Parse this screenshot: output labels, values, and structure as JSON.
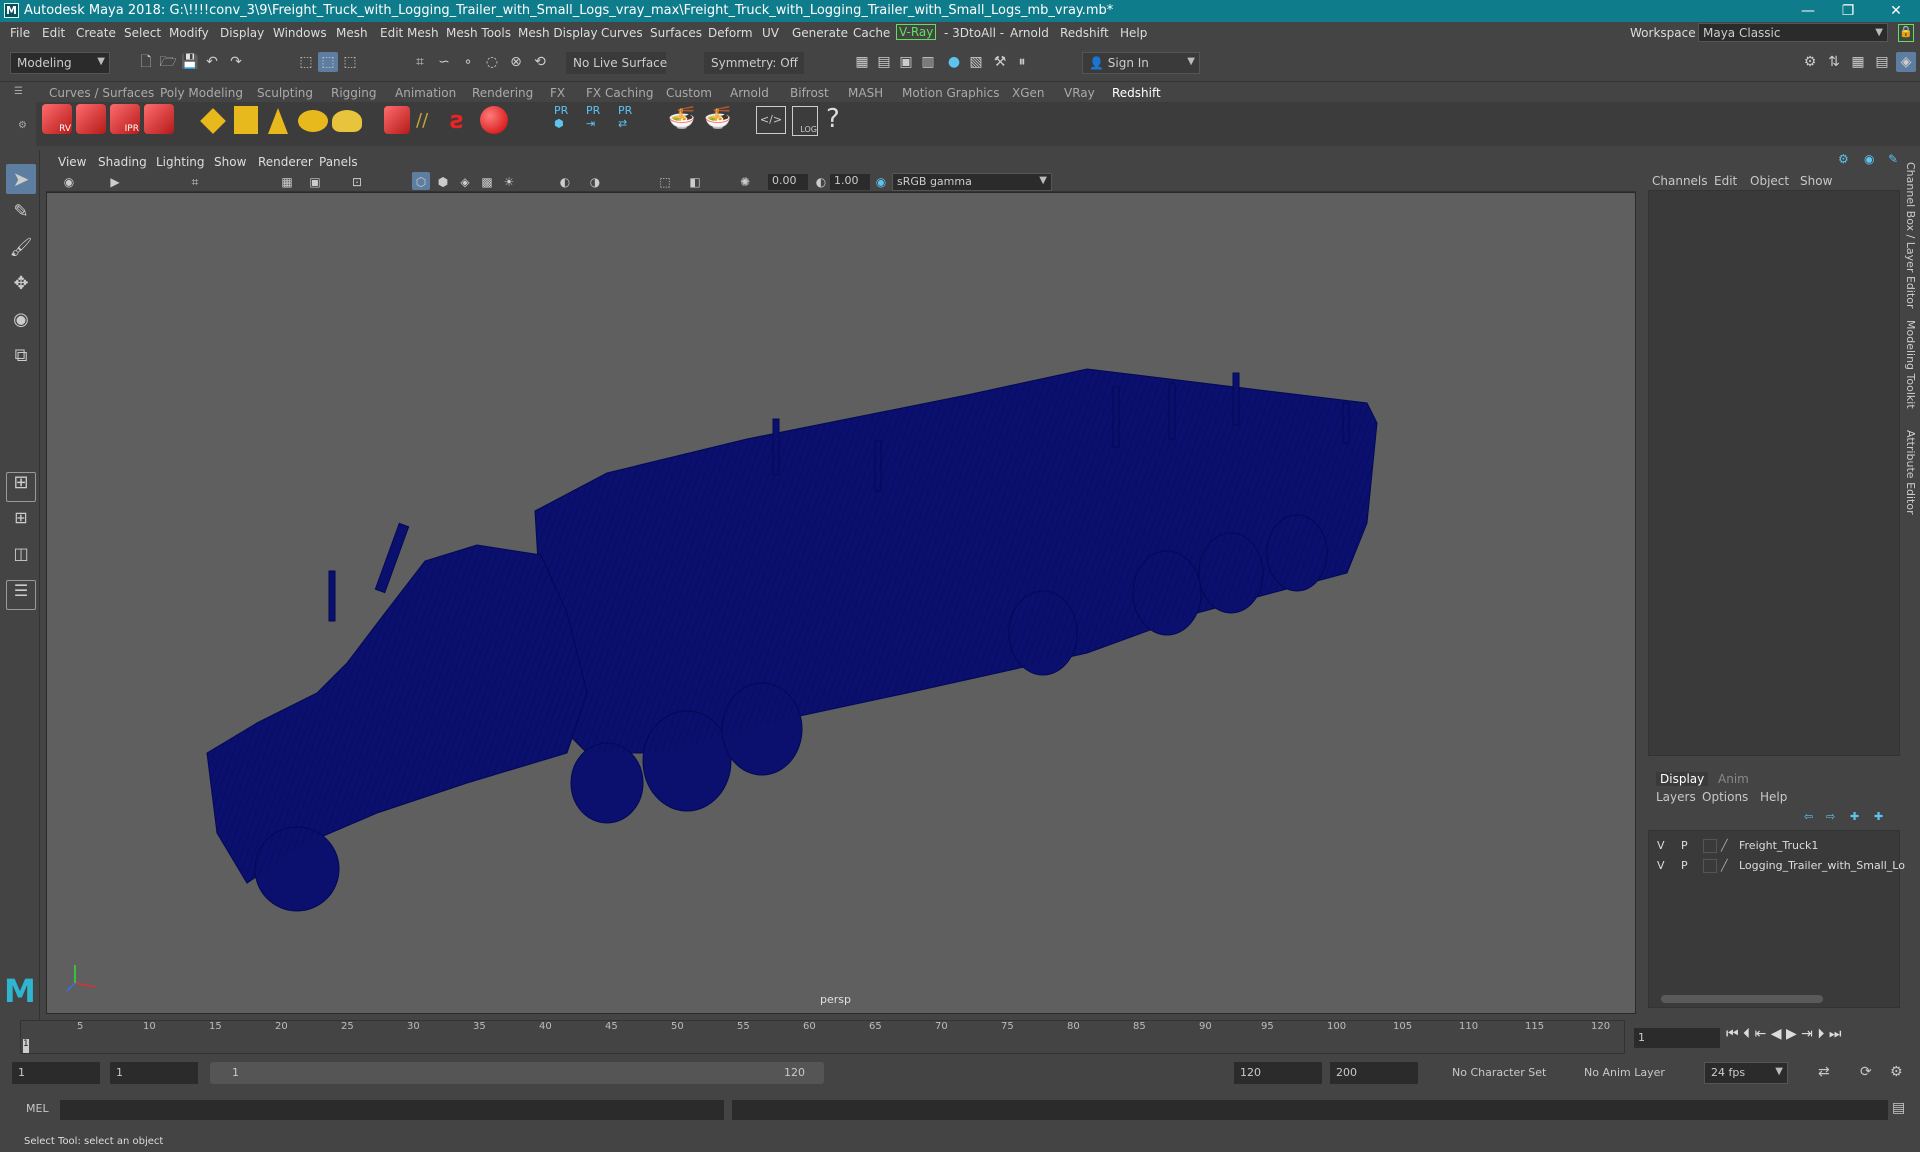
{
  "title": "Autodesk Maya 2018: G:\\!!!!conv_3\\9\\Freight_Truck_with_Logging_Trailer_with_Small_Logs_vray_max\\Freight_Truck_with_Logging_Trailer_with_Small_Logs_mb_vray.mb*",
  "window_controls": {
    "minimize": "—",
    "restore": "❐",
    "close": "✕"
  },
  "menus": [
    "File",
    "Edit",
    "Create",
    "Select",
    "Modify",
    "Display",
    "Windows",
    "Mesh",
    "Edit Mesh",
    "Mesh Tools",
    "Mesh Display",
    "Curves",
    "Surfaces",
    "Deform",
    "UV",
    "Generate",
    "Cache",
    "V-Ray",
    "- 3DtoAll -",
    "Arnold",
    "Redshift",
    "Help"
  ],
  "workspace": {
    "label": "Workspace :",
    "value": "Maya Classic"
  },
  "toolbar": {
    "mode": "Modeling",
    "live_surface": "No Live Surface",
    "symmetry": "Symmetry: Off",
    "sign_in": "Sign In"
  },
  "shelf_tabs": [
    "Curves / Surfaces",
    "Poly Modeling",
    "Sculpting",
    "Rigging",
    "Animation",
    "Rendering",
    "FX",
    "FX Caching",
    "Custom",
    "Arnold",
    "Bifrost",
    "MASH",
    "Motion Graphics",
    "XGen",
    "VRay",
    "Redshift"
  ],
  "shelf_active": "Redshift",
  "shelf_icons": {
    "rv": "RV",
    "ipr": "IPR",
    "pr1": "PR",
    "pr2": "PR",
    "pr3": "PR",
    "log": "LOG"
  },
  "viewport": {
    "menus": [
      "View",
      "Shading",
      "Lighting",
      "Show",
      "Renderer",
      "Panels"
    ],
    "exposure": "0.00",
    "gamma": "1.00",
    "color_space": "sRGB gamma",
    "camera_label": "persp",
    "wire_color": "#0b0f6e"
  },
  "channel_box": {
    "menus": [
      "Channels",
      "Edit",
      "Object",
      "Show"
    ],
    "side_tabs": [
      "Channel Box / Layer Editor",
      "Modeling Toolkit",
      "Attribute Editor"
    ]
  },
  "layer_editor": {
    "tabs": [
      "Display",
      "Anim"
    ],
    "menus": [
      "Layers",
      "Options",
      "Help"
    ],
    "layers": [
      {
        "v": "V",
        "p": "P",
        "name": "Freight_Truck1"
      },
      {
        "v": "V",
        "p": "P",
        "name": "Logging_Trailer_with_Small_Lo"
      }
    ]
  },
  "timeline": {
    "ticks": [
      "5",
      "10",
      "15",
      "20",
      "25",
      "30",
      "35",
      "40",
      "45",
      "50",
      "55",
      "60",
      "65",
      "70",
      "75",
      "80",
      "85",
      "90",
      "95",
      "100",
      "105",
      "110",
      "115",
      "120"
    ],
    "current_frame": "1",
    "current_marker": "1"
  },
  "range": {
    "start": "1",
    "playback_start": "1",
    "slider_start": "1",
    "slider_end": "120",
    "playback_end": "120",
    "end": "200",
    "character_set": "No Character Set",
    "anim_layer": "No Anim Layer",
    "fps": "24 fps"
  },
  "command": {
    "lang": "MEL"
  },
  "status": "Select Tool: select an object"
}
